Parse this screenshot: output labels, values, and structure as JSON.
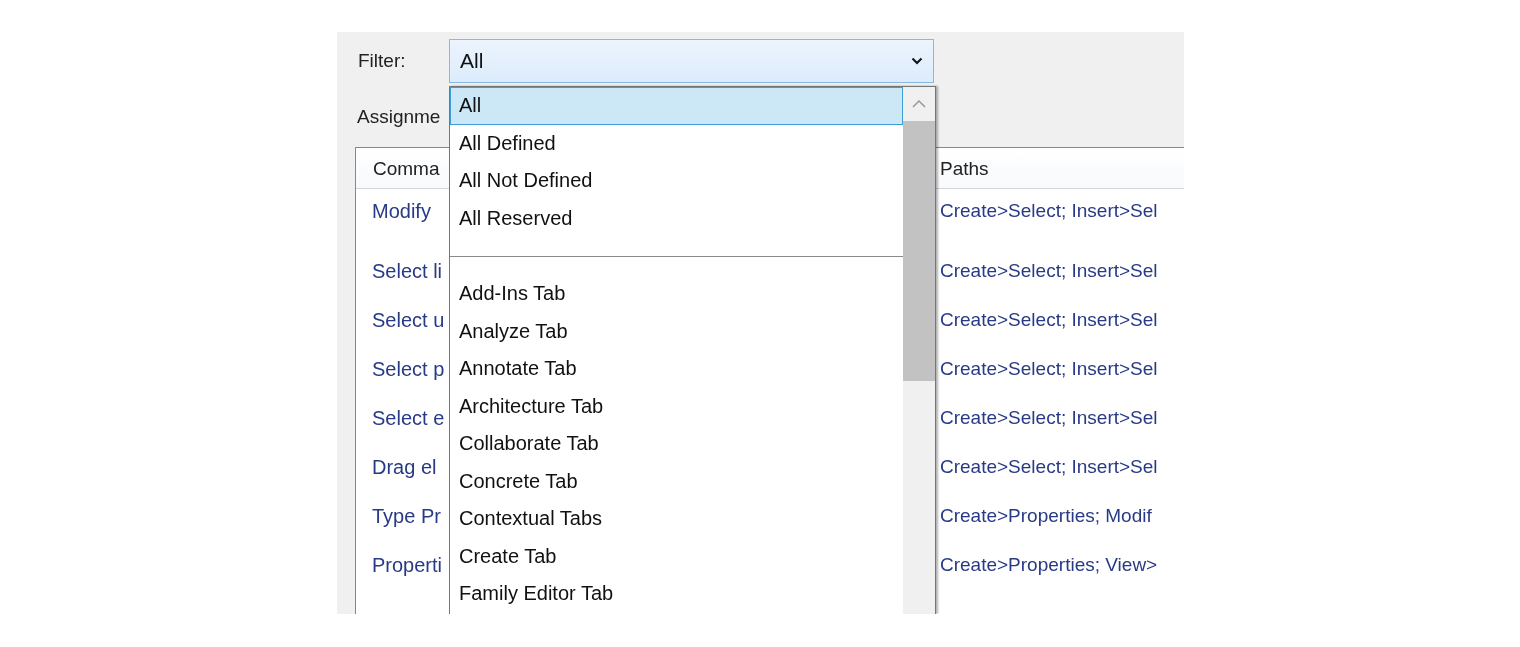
{
  "filter": {
    "label": "Filter:",
    "value": "All",
    "expanded": true
  },
  "assignments_label": "Assignme",
  "table": {
    "columns": [
      "Comma",
      "Paths"
    ],
    "rows": [
      {
        "cells": [
          "Modify",
          "Create>Select; Insert>Sel"
        ]
      },
      {
        "cells": [
          "Select li",
          "Create>Select; Insert>Sel"
        ]
      },
      {
        "cells": [
          "Select u",
          "Create>Select; Insert>Sel"
        ]
      },
      {
        "cells": [
          "Select p",
          "Create>Select; Insert>Sel"
        ]
      },
      {
        "cells": [
          "Select e",
          "Create>Select; Insert>Sel"
        ]
      },
      {
        "cells": [
          "Drag el",
          "Create>Select; Insert>Sel"
        ]
      },
      {
        "cells": [
          "Type Pr",
          "Create>Properties; Modif"
        ]
      },
      {
        "cells": [
          "Properti",
          "Create>Properties; View>"
        ]
      }
    ]
  },
  "dropdown": {
    "items": [
      {
        "kind": "option",
        "label": "All",
        "selected": true
      },
      {
        "kind": "option",
        "label": "All Defined",
        "selected": false
      },
      {
        "kind": "option",
        "label": "All Not Defined",
        "selected": false
      },
      {
        "kind": "option",
        "label": "All Reserved",
        "selected": false
      },
      {
        "kind": "separator"
      },
      {
        "kind": "option",
        "label": "Add-Ins Tab",
        "selected": false
      },
      {
        "kind": "option",
        "label": "Analyze Tab",
        "selected": false
      },
      {
        "kind": "option",
        "label": "Annotate Tab",
        "selected": false
      },
      {
        "kind": "option",
        "label": "Architecture Tab",
        "selected": false
      },
      {
        "kind": "option",
        "label": "Collaborate Tab",
        "selected": false
      },
      {
        "kind": "option",
        "label": "Concrete Tab",
        "selected": false
      },
      {
        "kind": "option",
        "label": "Contextual Tabs",
        "selected": false
      },
      {
        "kind": "option",
        "label": "Create Tab",
        "selected": false
      },
      {
        "kind": "option",
        "label": "Family Editor Tab",
        "selected": false
      }
    ]
  }
}
